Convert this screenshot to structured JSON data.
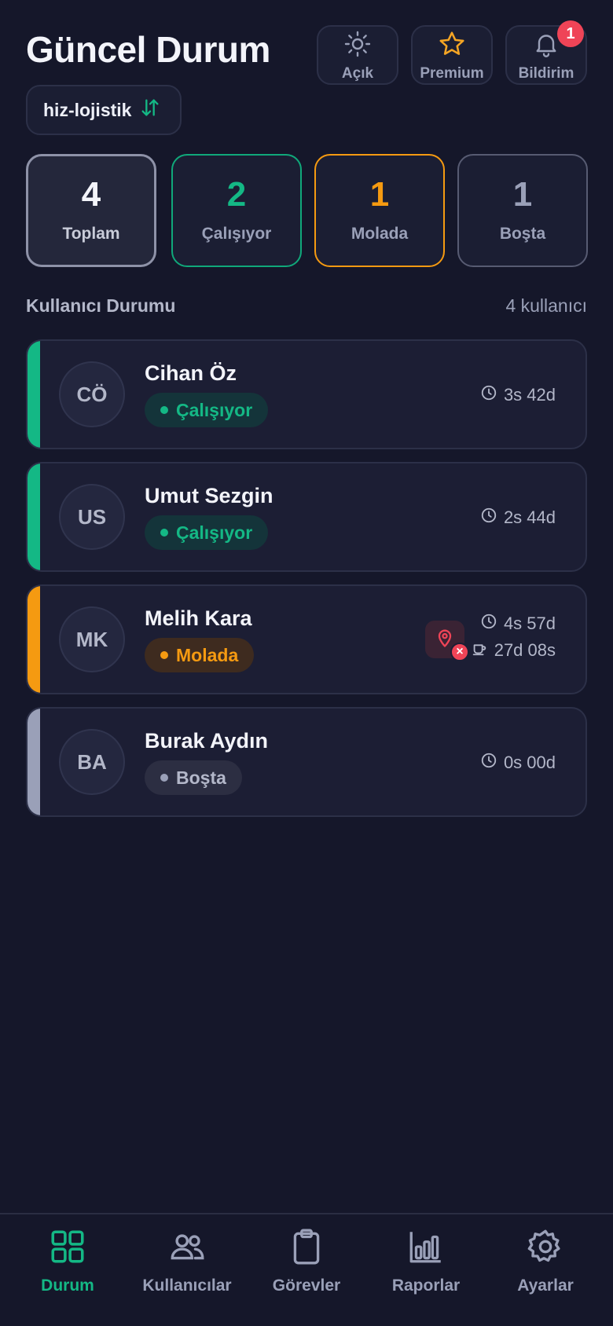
{
  "header": {
    "title": "Güncel Durum",
    "buttons": [
      {
        "label": "Açık",
        "icon": "sun-icon"
      },
      {
        "label": "Premium",
        "icon": "star-icon"
      },
      {
        "label": "Bildirim",
        "icon": "bell-icon",
        "badge": "1"
      }
    ]
  },
  "company": {
    "name": "hiz-lojistik",
    "icon": "swap-arrows-icon"
  },
  "stats": {
    "total": {
      "value": "4",
      "label": "Toplam"
    },
    "working": {
      "value": "2",
      "label": "Çalışıyor"
    },
    "break": {
      "value": "1",
      "label": "Molada"
    },
    "idle": {
      "value": "1",
      "label": "Boşta"
    }
  },
  "section": {
    "title": "Kullanıcı Durumu",
    "count": "4 kullanıcı"
  },
  "users": [
    {
      "initials": "CÖ",
      "name": "Cihan Öz",
      "status": "Çalışıyor",
      "time": "3s 42d"
    },
    {
      "initials": "US",
      "name": "Umut Sezgin",
      "status": "Çalışıyor",
      "time": "2s 44d"
    },
    {
      "initials": "MK",
      "name": "Melih Kara",
      "status": "Molada",
      "time": "4s 57d",
      "break_time": "27d 08s",
      "location_alert": "×"
    },
    {
      "initials": "BA",
      "name": "Burak Aydın",
      "status": "Boşta",
      "time": "0s 00d"
    }
  ],
  "nav": [
    {
      "label": "Durum",
      "icon": "grid-icon",
      "active": true
    },
    {
      "label": "Kullanıcılar",
      "icon": "users-icon"
    },
    {
      "label": "Görevler",
      "icon": "clipboard-icon"
    },
    {
      "label": "Raporlar",
      "icon": "bar-chart-icon"
    },
    {
      "label": "Ayarlar",
      "icon": "gear-icon"
    }
  ],
  "colors": {
    "background": "#15172a",
    "working": "#14b885",
    "break": "#f59a11",
    "idle": "#9aa0b8",
    "alert": "#ef4457",
    "premium_star": "#f5a524"
  }
}
